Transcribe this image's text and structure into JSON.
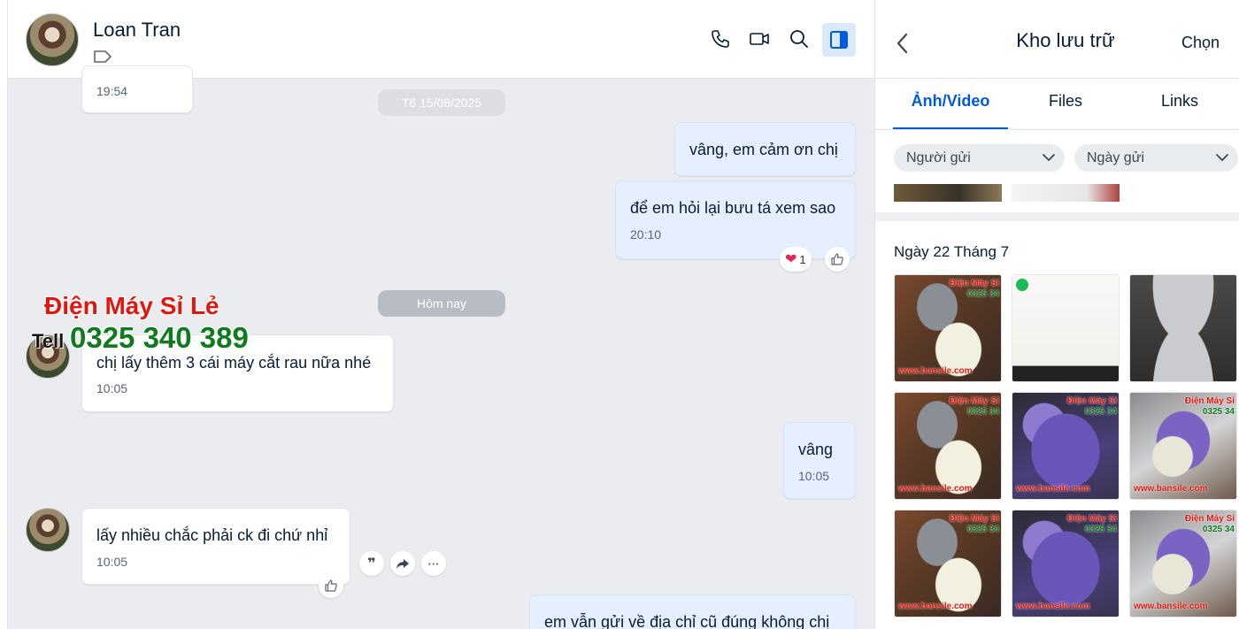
{
  "chat": {
    "contact_name": "Loan Tran",
    "messages": [
      {
        "id": "m0",
        "dir": "in",
        "time": "19:54"
      },
      {
        "id": "m1",
        "dir": "out",
        "text": "vâng, em cảm ơn chị"
      },
      {
        "id": "m2",
        "dir": "out",
        "text": "để em hỏi lại bưu tá xem sao",
        "time": "20:10",
        "reaction_count": "1"
      },
      {
        "id": "m3",
        "dir": "in",
        "text": "chị lấy thêm 3 cái máy cắt rau nữa nhé",
        "time": "10:05"
      },
      {
        "id": "m4",
        "dir": "out",
        "text": "vâng",
        "time": "10:05"
      },
      {
        "id": "m5",
        "dir": "in",
        "text": "lấy nhiều chắc phải ck đi chứ nhỉ",
        "time": "10:05"
      },
      {
        "id": "m6",
        "dir": "out",
        "text": "em vẫn gửi về địa chỉ cũ đúng không chị"
      }
    ],
    "separators": {
      "date": "T6 15/08/2025",
      "today": "Hôm nay"
    },
    "quote_glyph": "❞",
    "more_glyph": "···"
  },
  "watermark": {
    "shop": "Điện Máy Sỉ Lẻ",
    "tell": "Tell",
    "phone": "0325 340 389"
  },
  "panel": {
    "title": "Kho lưu trữ",
    "select": "Chọn",
    "tabs": [
      "Ảnh/Video",
      "Files",
      "Links"
    ],
    "active_tab": "Ảnh/Video",
    "filters": {
      "sender": "Người gửi",
      "date": "Ngày gửi"
    },
    "date_group": "Ngày 22 Tháng 7",
    "thumbs": [
      {
        "kind": "cabbage",
        "wm": "Điện Máy Sỉ",
        "wm2": "0325 34",
        "site": "www.bansile.com"
      },
      {
        "kind": "receipt"
      },
      {
        "kind": "blade"
      },
      {
        "kind": "cabbage",
        "wm": "Điện Máy Sỉ",
        "wm2": "0325 34",
        "site": "www.bansile.com"
      },
      {
        "kind": "purple",
        "wm": "Điện Máy Sỉ",
        "wm2": "0325 34",
        "site": "www.bansile.com"
      },
      {
        "kind": "mix",
        "wm": "Điện Máy Sỉ",
        "wm2": "0325 34",
        "site": "www.bansile.com"
      },
      {
        "kind": "cabbage",
        "wm": "Điện Máy Sỉ",
        "wm2": "0325 34",
        "site": "www.bansile.com"
      },
      {
        "kind": "purple",
        "wm": "Điện Máy Sỉ",
        "wm2": "0325 34",
        "site": "www.bansile.com"
      },
      {
        "kind": "mix",
        "wm": "Điện Máy Sỉ",
        "wm2": "0325 34",
        "site": "www.bansile.com"
      }
    ]
  },
  "colors": {
    "accent": "#005ae0",
    "out_bubble": "#e5efff",
    "chat_bg": "#ebecf0",
    "watermark_red": "#e3160e",
    "watermark_green": "#0f7a1f"
  }
}
